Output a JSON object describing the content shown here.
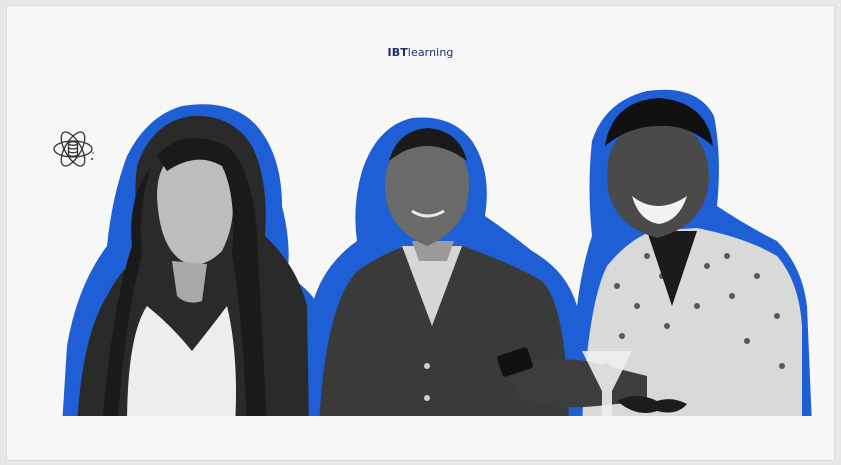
{
  "brand": {
    "logo_bold": "IBT",
    "logo_light": "learning"
  },
  "colors": {
    "accent_blue": "#1f5fd6",
    "brand_navy": "#1b2f6b",
    "background": "#f7f7f7"
  },
  "icons": {
    "atom": "atom-database-icon"
  },
  "people": [
    {
      "name": "person-woman-left"
    },
    {
      "name": "person-man-center"
    },
    {
      "name": "person-man-right-smartphone"
    }
  ]
}
